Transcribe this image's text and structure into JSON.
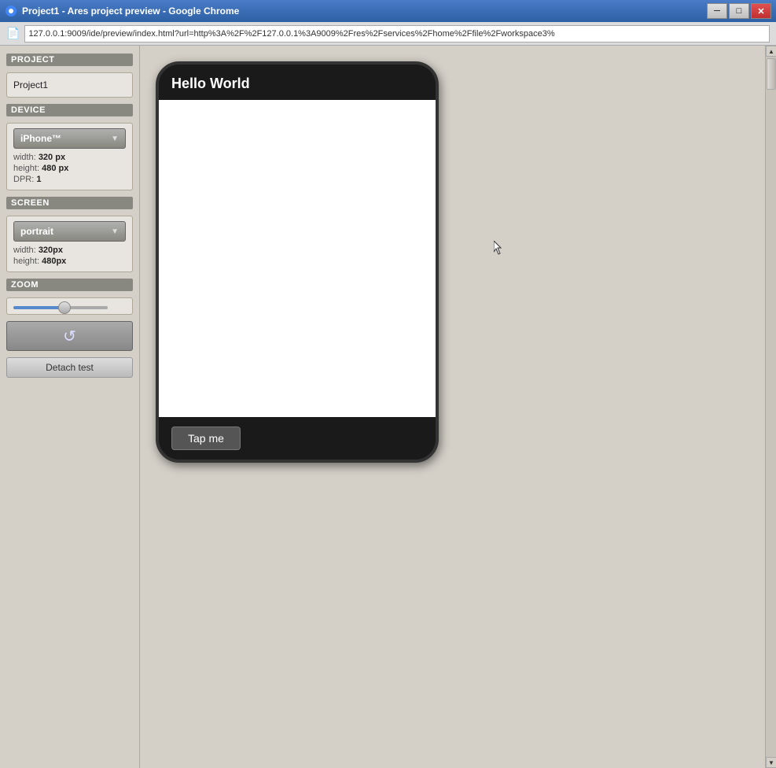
{
  "window": {
    "title": "Project1 - Ares project preview - Google Chrome",
    "icon": "chrome-icon"
  },
  "titlebar": {
    "title": "Project1 - Ares project preview - Google Chrome",
    "minimize_label": "─",
    "maximize_label": "□",
    "close_label": "✕"
  },
  "addressbar": {
    "url": "127.0.0.1:9009/ide/preview/index.html?url=http%3A%2F%2F127.0.0.1%3A9009%2Fres%2Fservices%2Fhome%2Ffile%2Fworkspace3%"
  },
  "sidebar": {
    "project_section": "PROJECT",
    "project_name": "Project1",
    "device_section": "DEVICE",
    "device_selected": "iPhone™",
    "device_dropdown_arrow": "▼",
    "width_label": "width:",
    "width_value": "320 px",
    "height_label": "height:",
    "height_value": "480 px",
    "dpr_label": "DPR:",
    "dpr_value": "1",
    "screen_section": "SCREEN",
    "screen_selected": "portrait",
    "screen_dropdown_arrow": "▼",
    "screen_width_label": "width:",
    "screen_width_value": "320px",
    "screen_height_label": "height:",
    "screen_height_value": "480px",
    "zoom_section": "ZOOM",
    "zoom_value": 55,
    "reload_label": "↺",
    "detach_label": "Detach test"
  },
  "phone": {
    "header_text": "Hello World",
    "footer_button": "Tap me"
  }
}
